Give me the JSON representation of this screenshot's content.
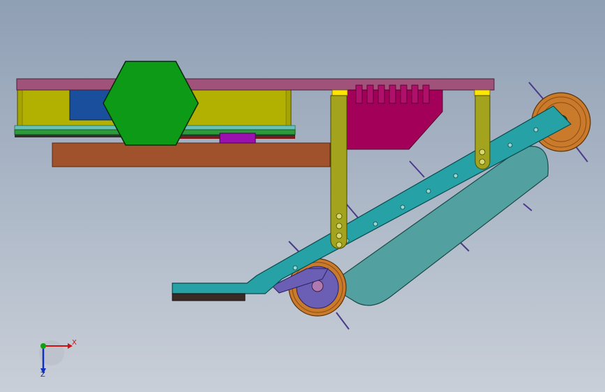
{
  "colors": {
    "background_top": "#8f9fb4",
    "background_bottom": "#c9cfd8",
    "top_plate": "#a0527a",
    "yellow_frame": "#a6a400",
    "green_hex": "#0c9a17",
    "green_strip": "#2d9a3c",
    "cyan_strip": "#66c2b4",
    "beam_brown": "#a0522d",
    "magenta_block": "#a3005a",
    "purple_block": "#9d10b0",
    "blue_block": "#1a4f9e",
    "link_olive": "#a3a31e",
    "conveyor_teal": "#26a1a5",
    "conveyor_belt": "#52a09f",
    "roller_orange": "#c97b2b",
    "roller_hub_purple": "#6a5fb4",
    "axis_x_red": "#d01010",
    "axis_y_green": "#10a010",
    "axis_z_blue": "#1030c0"
  },
  "axis_triad": {
    "x_label": "X",
    "z_label": "Z",
    "icon": "coordinate-triad-icon"
  }
}
